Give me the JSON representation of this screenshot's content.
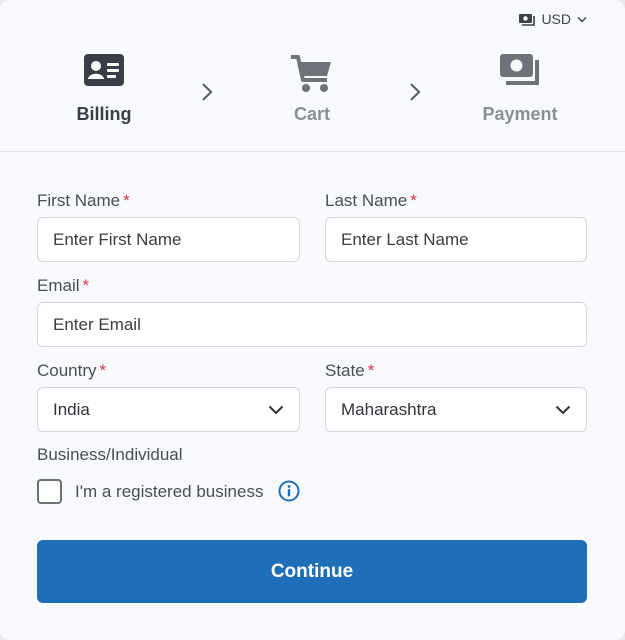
{
  "header": {
    "currency": "USD",
    "currency_icon": "money-icon"
  },
  "steps": [
    {
      "label": "Billing",
      "icon": "id-card-icon",
      "state": "active"
    },
    {
      "label": "Cart",
      "icon": "cart-icon",
      "state": "inactive"
    },
    {
      "label": "Payment",
      "icon": "money-stack-icon",
      "state": "inactive"
    }
  ],
  "form": {
    "first_name": {
      "label": "First Name",
      "required_mark": "*",
      "placeholder": "Enter First Name",
      "value": ""
    },
    "last_name": {
      "label": "Last Name",
      "required_mark": "*",
      "placeholder": "Enter Last Name",
      "value": ""
    },
    "email": {
      "label": "Email",
      "required_mark": "*",
      "placeholder": "Enter Email",
      "value": ""
    },
    "country": {
      "label": "Country",
      "required_mark": "*",
      "value": "India"
    },
    "state": {
      "label": "State",
      "required_mark": "*",
      "value": "Maharashtra"
    },
    "business": {
      "label": "Business/Individual",
      "checkbox_label": "I'm a registered business",
      "checked": false
    }
  },
  "actions": {
    "continue_label": "Continue"
  },
  "colors": {
    "primary": "#1f6fb8",
    "required": "#d0344a",
    "info": "#1f6fb8"
  }
}
